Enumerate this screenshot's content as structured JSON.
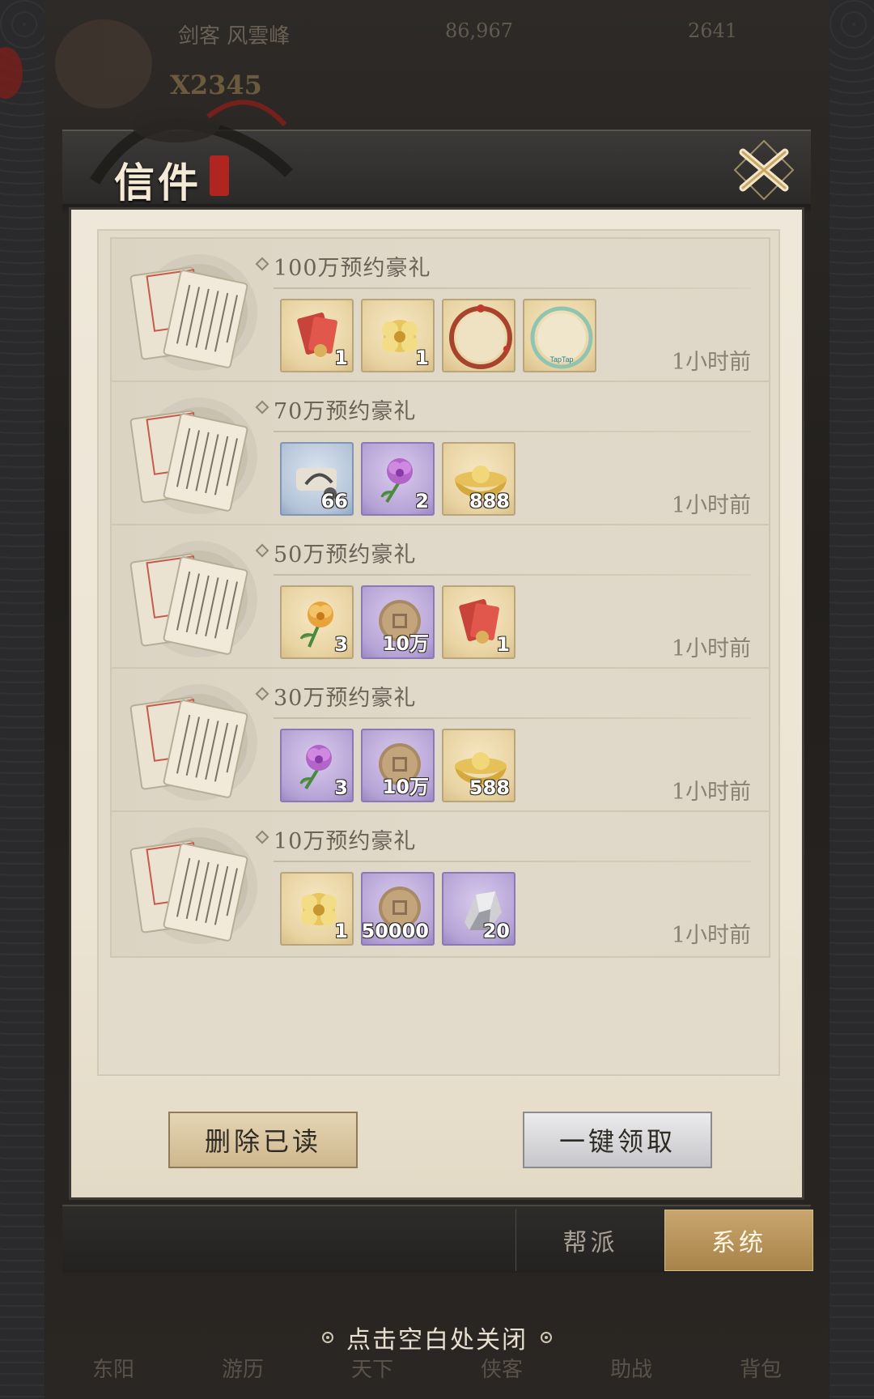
{
  "hud": {
    "player_name": "剑客 风雲峰",
    "power": "X2345",
    "coins": "86,967",
    "gold": "2641"
  },
  "bottom_nav": {
    "items": [
      "东阳",
      "游历",
      "天下",
      "侠客",
      "助战",
      "背包"
    ]
  },
  "dialog": {
    "title": "信件",
    "close_icon": "close-x-icon"
  },
  "mails": [
    {
      "title": "100万预约豪礼",
      "time": "1小时前",
      "rewards": [
        {
          "icon": "red-envelope-icon",
          "rarity": "gold",
          "count": "1"
        },
        {
          "icon": "gold-flower-icon",
          "rarity": "gold",
          "count": "1"
        },
        {
          "icon": "avatar-frame-red-icon",
          "rarity": "gold",
          "count": ""
        },
        {
          "icon": "avatar-frame-taptap-icon",
          "rarity": "gold",
          "count": "",
          "label": "TapTap"
        }
      ]
    },
    {
      "title": "70万预约豪礼",
      "time": "1小时前",
      "rewards": [
        {
          "icon": "scroll-horse-icon",
          "rarity": "blue",
          "count": "66"
        },
        {
          "icon": "purple-flower-icon",
          "rarity": "purple",
          "count": "2"
        },
        {
          "icon": "gold-ingot-icon",
          "rarity": "gold",
          "count": "888"
        }
      ]
    },
    {
      "title": "50万预约豪礼",
      "time": "1小时前",
      "rewards": [
        {
          "icon": "orange-flower-icon",
          "rarity": "gold",
          "count": "3"
        },
        {
          "icon": "copper-coin-icon",
          "rarity": "purple",
          "count": "10万"
        },
        {
          "icon": "red-envelope-icon",
          "rarity": "gold",
          "count": "1"
        }
      ]
    },
    {
      "title": "30万预约豪礼",
      "time": "1小时前",
      "rewards": [
        {
          "icon": "purple-flower-icon",
          "rarity": "purple",
          "count": "3"
        },
        {
          "icon": "copper-coin-icon",
          "rarity": "purple",
          "count": "10万"
        },
        {
          "icon": "gold-ingot-icon",
          "rarity": "gold",
          "count": "588"
        }
      ]
    },
    {
      "title": "10万预约豪礼",
      "time": "1小时前",
      "rewards": [
        {
          "icon": "gold-flower-icon",
          "rarity": "gold",
          "count": "1"
        },
        {
          "icon": "copper-coin-icon",
          "rarity": "purple",
          "count": "50000"
        },
        {
          "icon": "ore-stone-icon",
          "rarity": "purple",
          "count": "20"
        }
      ]
    }
  ],
  "buttons": {
    "delete_read": "删除已读",
    "claim_all": "一键领取"
  },
  "tabs": {
    "guild": "帮派",
    "system": "系统",
    "active": "system"
  },
  "close_hint": "点击空白处关闭",
  "colors": {
    "accent_gold": "#c8a66e",
    "parchment": "#efe8da",
    "dark_frame": "#2b2928",
    "purple_rarity": "#b6a3d6",
    "blue_rarity": "#b3c3d8",
    "gold_rarity": "#e8d3a2"
  }
}
